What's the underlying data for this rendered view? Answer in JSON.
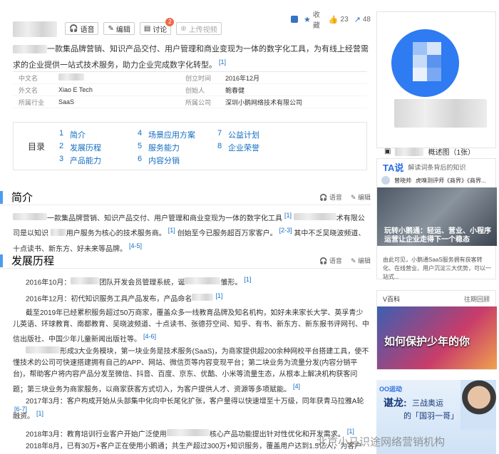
{
  "toolbar": {
    "add_label": "",
    "fav_label": "收藏",
    "like_count": "23",
    "share_count": "48"
  },
  "title_buttons": {
    "voice": "语音",
    "edit": "编辑",
    "discuss": "讨论",
    "discuss_count": "2",
    "upload_video": "上传视频"
  },
  "summary": {
    "text": "一款集品牌营销、知识产品交付、用户管理和商业变现为一体的数字化工具，为有线上经营需求的企业提供一站式技术服务，助力企业完成数字化转型。",
    "ref": "[1]"
  },
  "infobox": {
    "rows": [
      {
        "k1": "中文名",
        "v1": "",
        "k2": "创立时间",
        "v2": "2016年12月"
      },
      {
        "k1": "外文名",
        "v1": "Xiao E Tech",
        "k2": "创始人",
        "v2": "鲍春健"
      },
      {
        "k1": "所属行业",
        "v1": "SaaS",
        "k2": "所属公司",
        "v2": "深圳小鹅网络技术有限公司"
      }
    ]
  },
  "toc": {
    "label": "目录",
    "col1": [
      {
        "n": "1",
        "t": "简介"
      },
      {
        "n": "2",
        "t": "发展历程"
      },
      {
        "n": "3",
        "t": "产品能力"
      }
    ],
    "col2": [
      {
        "n": "4",
        "t": "场景应用方案"
      },
      {
        "n": "5",
        "t": "服务能力"
      },
      {
        "n": "6",
        "t": "内容分销"
      }
    ],
    "col3": [
      {
        "n": "7",
        "t": "公益计划"
      },
      {
        "n": "8",
        "t": "企业荣誉"
      }
    ]
  },
  "sections": {
    "intro": {
      "title": "简介",
      "voice": "语音",
      "edit": "编辑"
    },
    "history": {
      "title": "发展历程",
      "voice": "语音",
      "edit": "编辑"
    }
  },
  "intro_text": {
    "a": "一款集品牌营销、知识产品交付、用户管理和商业变现为一体的数字化工具",
    "ref1": "[1]",
    "b": "术有限公司是以知识",
    "c": "用户服务为核心的技术服务商。",
    "ref2": "[1]",
    "d": "创始至今已服务超百万家客户。",
    "ref3": "[2-3]",
    "e": "其中不乏吴晓波频道、十点读书、新东方、好未来等品牌。",
    "ref4": "[4-5]"
  },
  "history": [
    {
      "text": "2016年10月：",
      "rest": "团队开发会员管理系统，诞",
      "tail": "雏形。",
      "ref": "[1]"
    },
    {
      "text": "2016年12月：初代知识服务工具产品发布，产品命名",
      "rest": "",
      "tail": "",
      "ref": "[1]"
    },
    {
      "text": "截至2019年已经累积服务超过50万商家，覆盖众多一线教育品牌及知名机构，如好未来家长大学、英孚青少儿英语、环球教育、南都教育、吴晓波频道、十点读书、张德芬空间、知乎、有书、新东方、新东报书评网刊、中信出版社、中国少年儿童新闻出版社等。",
      "rest": "",
      "tail": "",
      "ref": "[4-6]"
    },
    {
      "text": "形成3大业务模块，第一块业务是技术服务(SaaS)，为商家提供超200余种网校平台搭建工具，使不懂技术的公司可快速搭建拥有自己的APP、网站、微信页等内容变现平台；第二块业务为流量分发(内容分销平台)，帮助客户将内容产品分发至微信、抖音、百度、京东、优酷、小米等流量生态，从根本上解决机构获客问题；第三块业务为商家服务，以商家获客方式切入，为客户提供人才、资源等多项赋能。",
      "rest": "",
      "tail": "",
      "ref": "[4]"
    },
    {
      "text": "2017年3月：客户构成开始从头部集中化向中长尾化扩张，客户量得以快速增至十万级，同年获青马拉雅A轮融资。",
      "rest": "",
      "tail": "",
      "ref": "[1]"
    },
    {
      "text": "",
      "rest": "",
      "tail": "",
      "ref": "[6-7]"
    },
    {
      "text": "2018年3月：教育培训行业客户开始广泛使用",
      "rest": "",
      "tail": "核心产品功能提出针对性优化和开发需求。",
      "ref": "[1]"
    },
    {
      "text": "2018年8月，已有30万+客户正在使用小鹅通；共生产超过300万+知识服务，覆盖用户达到1.5亿人，为客户",
      "rest": "",
      "tail": "",
      "ref": ""
    }
  ],
  "album": {
    "caption": "概述图（1张）"
  },
  "ta": {
    "logo": "TA说",
    "tagline": "解读词条背后的知识",
    "author": "曾晓帅",
    "author_meta": "虎嗅测评师《商界》《商界...",
    "overlay": "玩转小鹅通：轻运、营业、小程序运营让企业走得下一个稳态",
    "desc": "由此可见，小鹅通SaaS服务拥有获客转化、在线营业、用户沉淀三大优势，可以一站式..."
  },
  "vbaike": {
    "label": "V百科",
    "more": "往期回顾",
    "banner": "如何保护少年的你"
  },
  "ad": {
    "logo": "OO运动",
    "name": "谌龙:",
    "line1": "三战奥运",
    "line2": "的「国羽一哥」"
  },
  "watermark": "北京小马识途网络营销机构"
}
